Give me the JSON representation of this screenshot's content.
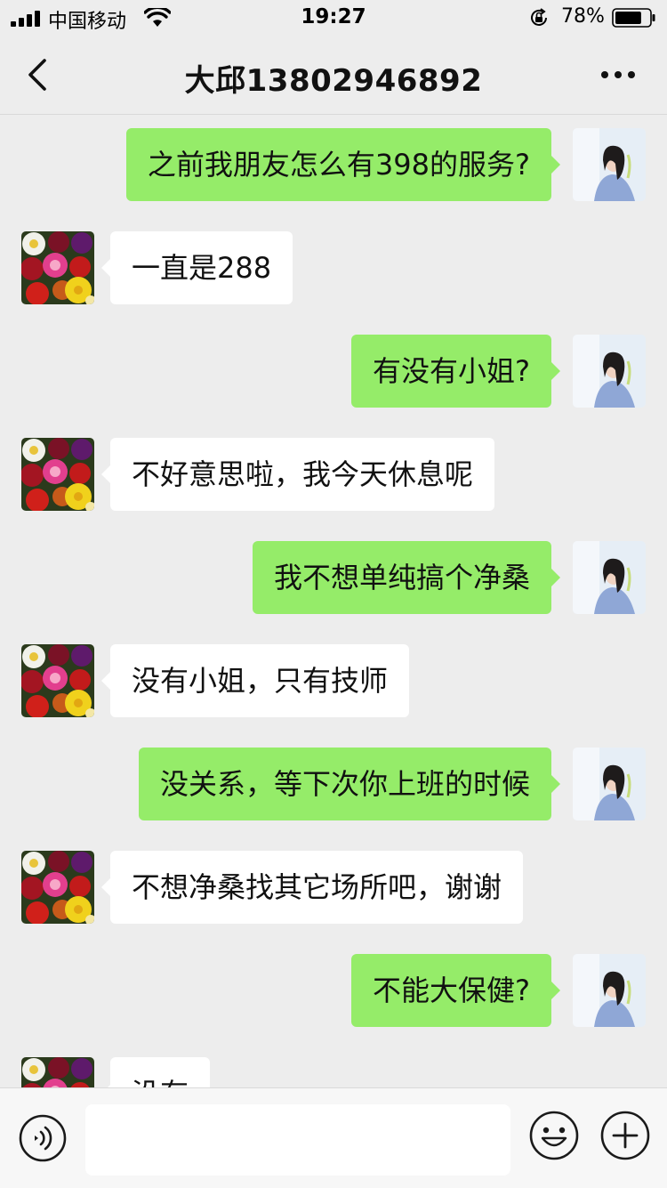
{
  "status_bar": {
    "carrier": "中国移动",
    "time": "19:27",
    "battery_percent": "78%",
    "battery_level": 0.78,
    "icons": [
      "signal-icon",
      "wifi-icon",
      "orientation-lock-icon",
      "battery-icon"
    ]
  },
  "header": {
    "title": "大邱13802946892",
    "back_icon": "chevron-left-icon",
    "more_icon": "more-dots-icon"
  },
  "messages": [
    {
      "side": "right",
      "text": "之前我朋友怎么有398的服务?"
    },
    {
      "side": "left",
      "text": "一直是288"
    },
    {
      "side": "right",
      "text": "有没有小姐?"
    },
    {
      "side": "left",
      "text": "不好意思啦，我今天休息呢"
    },
    {
      "side": "right",
      "text": "我不想单纯搞个净桑"
    },
    {
      "side": "left",
      "text": "没有小姐，只有技师"
    },
    {
      "side": "right",
      "text": "没关系，等下次你上班的时候"
    },
    {
      "side": "left",
      "text": "不想净桑找其它场所吧，谢谢"
    },
    {
      "side": "right",
      "text": "不能大保健?"
    },
    {
      "side": "left",
      "text": "没有"
    }
  ],
  "input_bar": {
    "input_value": "",
    "voice_icon": "voice-icon",
    "emoji_icon": "emoji-icon",
    "plus_icon": "plus-icon"
  },
  "colors": {
    "background": "#ededed",
    "sent_bubble": "#95ec69",
    "received_bubble": "#ffffff",
    "input_bar": "#f7f7f7"
  }
}
